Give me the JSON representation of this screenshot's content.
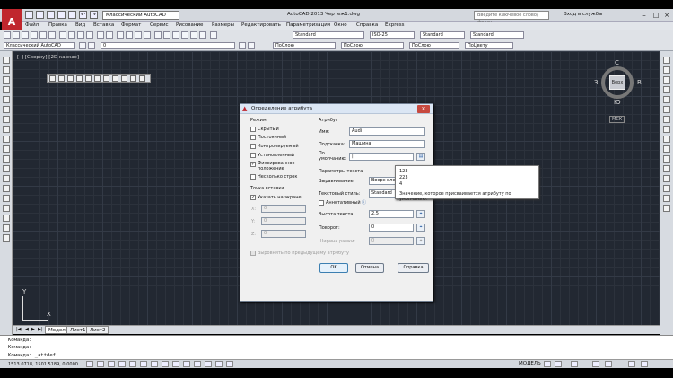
{
  "app": {
    "logo": "A",
    "workspace": "Классический AutoCAD",
    "title": "AutoCAD 2013  Чертеж1.dwg",
    "search_placeholder": "Введите ключевое слово/фразу",
    "services": "Вход в службы"
  },
  "menu": [
    "Файл",
    "Правка",
    "Вид",
    "Вставка",
    "Формат",
    "Сервис",
    "Рисование",
    "Размеры",
    "Редактировать",
    "Параметризация",
    "Окно",
    "Справка",
    "Express"
  ],
  "toolbar": {
    "workspace_combo": "Классический AutoCAD",
    "text_style": "Standard",
    "dim_style": "ISO-25",
    "table_style": "Standard",
    "mleader_style": "Standard",
    "layer_combo": "0",
    "color_combo": "ПоСлою",
    "linetype_combo": "ПоСлою",
    "lineweight_combo": "ПоСлою",
    "plotstyle_combo": "ПоЦвету"
  },
  "viewport": {
    "label": "[–] [Сверху] [2D каркас]"
  },
  "viewcube": {
    "north": "С",
    "south": "Ю",
    "west": "З",
    "east": "В",
    "face": "Верх",
    "wcs": "МСК"
  },
  "ucs": {
    "x": "X",
    "y": "Y"
  },
  "layout_tabs": [
    "Модель",
    "Лист1",
    "Лист2"
  ],
  "command": {
    "history1": "Команда:",
    "history2": "Команда:",
    "current": "Команда:  _attdef"
  },
  "status": {
    "coords": "1513.0718, 1501.5189, 0.0000",
    "model": "МОДЕЛЬ"
  },
  "dialog": {
    "title": "Определение атрибута",
    "mode_group": "Режим",
    "modes": [
      {
        "label": "Скрытый",
        "checked": false
      },
      {
        "label": "Постоянный",
        "checked": false
      },
      {
        "label": "Контролируемый",
        "checked": false
      },
      {
        "label": "Установленный",
        "checked": false
      },
      {
        "label": "Фиксированное",
        "checked": true
      },
      {
        "label": "положение",
        "checked": null
      },
      {
        "label": "Несколько строк",
        "checked": false
      }
    ],
    "insert_group": "Точка вставки",
    "specify_on_screen": "Указать на экране",
    "x_label": "X:",
    "y_label": "Y:",
    "z_label": "Z:",
    "x_val": "0",
    "y_val": "0",
    "z_val": "0",
    "attr_group": "Атрибут",
    "tag_label": "Имя:",
    "tag_val": "Audi",
    "prompt_label": "Подсказка:",
    "prompt_val": "Машина",
    "default_label1": "По",
    "default_label2": "умолчанию:",
    "default_val": "|",
    "text_group": "Параметры текста",
    "justify_label": "Выравнивание:",
    "justify_val": "Вверх влево",
    "style_label": "Текстовый стиль:",
    "style_val": "Standard",
    "annotative_label": "Аннотативный",
    "height_label": "Высота текста:",
    "height_val": "2.5",
    "rotation_label": "Поворот:",
    "rotation_val": "0",
    "boundary_label": "Ширина рамки:",
    "boundary_val": "0",
    "align_prev": "Выровнять по предыдущему атрибуту",
    "ok": "OK",
    "cancel": "Отмена",
    "help": "Справка"
  },
  "tooltip": {
    "items": [
      "123",
      "223",
      "4"
    ],
    "description": "Значение, которое присваивается атрибуту по умолчанию."
  }
}
